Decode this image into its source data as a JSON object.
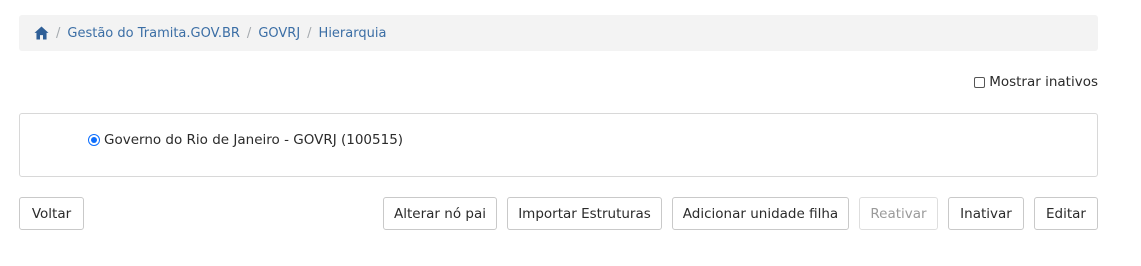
{
  "breadcrumb": {
    "home_icon": "home-icon",
    "separator": "/",
    "items": [
      {
        "label": "Gestão do Tramita.GOV.BR"
      },
      {
        "label": "GOVRJ"
      },
      {
        "label": "Hierarquia"
      }
    ]
  },
  "show_inactive": {
    "label": "Mostrar inativos",
    "checked": false
  },
  "tree": {
    "nodes": [
      {
        "label": "Governo do Rio de Janeiro - GOVRJ (100515)",
        "selected": true
      }
    ]
  },
  "actions": {
    "back_label": "Voltar",
    "change_parent_label": "Alterar nó pai",
    "import_label": "Importar Estruturas",
    "add_child_label": "Adicionar unidade filha",
    "reactivate_label": "Reativar",
    "inactivate_label": "Inativar",
    "edit_label": "Editar"
  },
  "colors": {
    "link": "#3b6ea5",
    "breadcrumb_bg": "#f3f3f3",
    "radio": "#0d6efd",
    "disabled_text": "#9a9a9a"
  }
}
